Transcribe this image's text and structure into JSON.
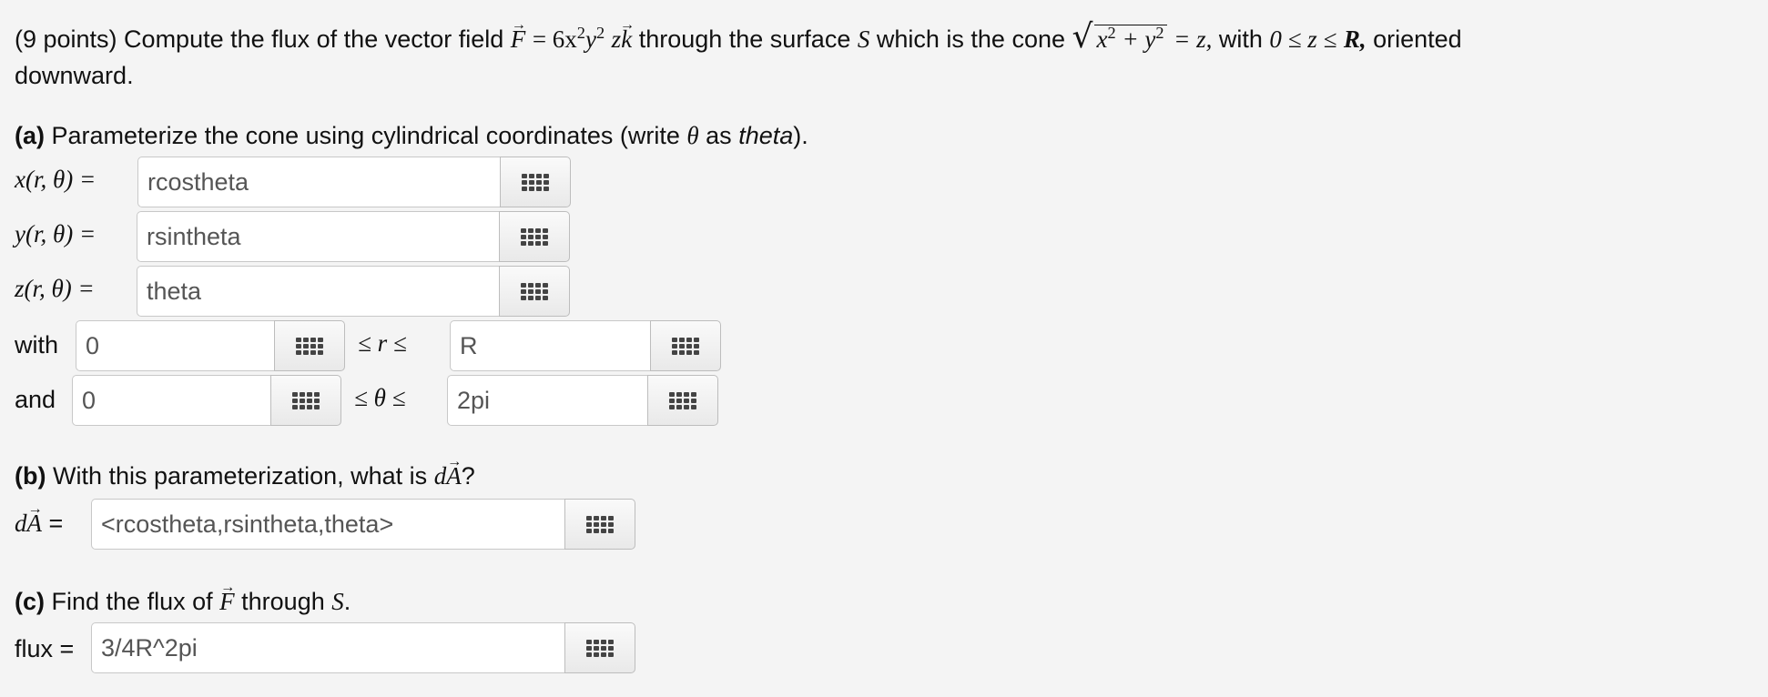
{
  "problem": {
    "points_prefix": "(9 points) Compute the flux of the vector field",
    "field_F": "F",
    "field_eq": "= 6x",
    "field_sup1": "2",
    "field_y": "y",
    "field_sup2": "2",
    "field_z": "z",
    "field_k": "k",
    "through": "through the surface",
    "surface": "S",
    "which_is": "which is the cone",
    "sqrt_content_x": "x",
    "sqrt_sup1": "2",
    "sqrt_plus": "+ y",
    "sqrt_sup2": "2",
    "eq_z": "= z,",
    "with": "with",
    "range": "0 ≤ z ≤",
    "range_R": "R,",
    "oriented": "oriented",
    "line2": "downward."
  },
  "part_a": {
    "tag": "(a)",
    "text": "Parameterize the cone using cylindrical coordinates (write",
    "theta_sym": "θ",
    "as": "as",
    "theta_word": "theta",
    "close": ").",
    "x_label": "x(r, θ) =",
    "y_label": "y(r, θ) =",
    "z_label": "z(r, θ) =",
    "x_value": "rcostheta",
    "y_value": "rsintheta",
    "z_value": "theta",
    "with_label": "with",
    "r_lower": "0",
    "r_relation": "≤ r ≤",
    "r_upper": "R",
    "and_label": "and",
    "theta_lower": "0",
    "theta_relation": "≤ θ ≤",
    "theta_upper": "2pi"
  },
  "part_b": {
    "tag": "(b)",
    "text": "With this parameterization, what is",
    "dA_d": "d",
    "dA_A": "A",
    "qmark": "?",
    "label_eq": "=",
    "value": "<rcostheta,rsintheta,theta>"
  },
  "part_c": {
    "tag": "(c)",
    "text_before": "Find the flux of",
    "F": "F",
    "text_after": "through",
    "S": "S",
    "period": ".",
    "label": "flux =",
    "value": "3/4R^2pi"
  },
  "icons": {
    "palette": "equation-palette-icon"
  }
}
